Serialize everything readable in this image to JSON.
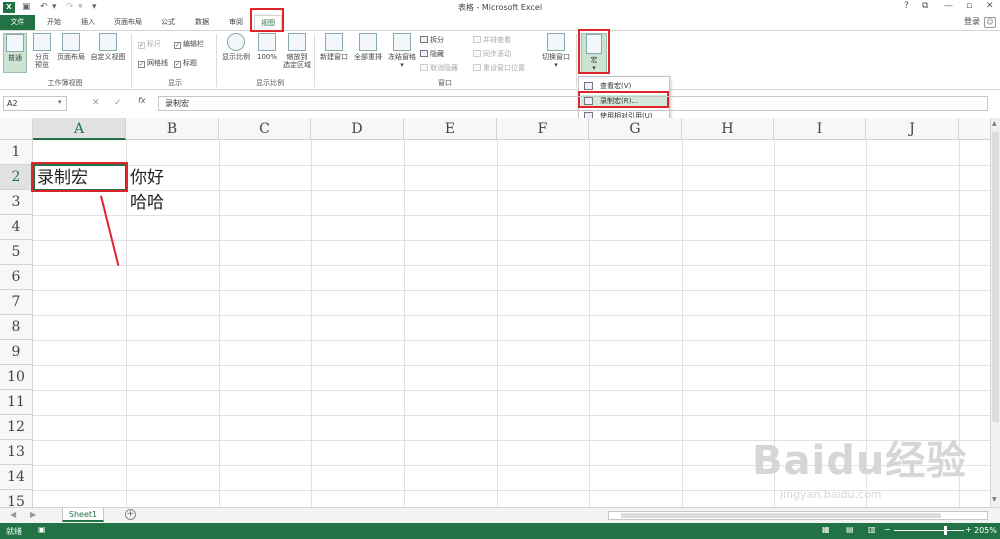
{
  "titlebar": {
    "title": "表格 - Microsoft Excel",
    "logo": "X"
  },
  "qat": {
    "save_icon": "save-icon",
    "undo": "↶",
    "redo": "↷",
    "customize": "▾"
  },
  "window_controls": {
    "help": "?",
    "restore": "⧉",
    "minimize": "—",
    "maximize": "▫",
    "close": "✕"
  },
  "tabs": [
    "文件",
    "开始",
    "插入",
    "页面布局",
    "公式",
    "数据",
    "审阅",
    "视图"
  ],
  "account": {
    "login": "登录"
  },
  "ribbon": {
    "workbook_views": {
      "label": "工作簿视图",
      "normal": "普通",
      "page_break_1": "分页",
      "page_break_2": "预览",
      "page_layout": "页面布局",
      "custom": "自定义视图"
    },
    "show": {
      "label": "显示",
      "ruler": "标尺",
      "gridlines": "网格线",
      "formula_bar": "编辑栏",
      "headings": "标题"
    },
    "zoom": {
      "label": "显示比例",
      "zoom": "显示比例",
      "hundred": "100%",
      "to_sel_1": "缩放到",
      "to_sel_2": "选定区域"
    },
    "window": {
      "label": "窗口",
      "new": "新建窗口",
      "arrange": "全部重排",
      "freeze": "冻结窗格",
      "split": "拆分",
      "hide": "隐藏",
      "unhide": "取消隐藏",
      "side_by_side": "并排查看",
      "sync": "同步滚动",
      "reset": "重设窗口位置",
      "switch": "切换窗口"
    },
    "macros": {
      "label": "宏",
      "button": "宏"
    }
  },
  "macro_menu": [
    "查看宏(V)",
    "录制宏(R)...",
    "使用相对引用(U)"
  ],
  "formula_bar": {
    "name_box": "A2",
    "cancel": "✕",
    "enter": "✓",
    "fx": "fx",
    "value": "录制宏"
  },
  "columns": [
    "A",
    "B",
    "C",
    "D",
    "E",
    "F",
    "G",
    "H",
    "I",
    "J"
  ],
  "rows": [
    "1",
    "2",
    "3",
    "4",
    "5",
    "6",
    "7",
    "8",
    "9",
    "10",
    "11",
    "12",
    "13",
    "14",
    "15"
  ],
  "cells": {
    "A2": "录制宏",
    "B2": "你好",
    "B3": "哈哈"
  },
  "sheets": {
    "active": "Sheet1",
    "add": "+"
  },
  "status": {
    "ready": "就绪",
    "zoom": "205%"
  },
  "watermark": {
    "brand": "Baidu经验",
    "url": "jingyan.baidu.com"
  },
  "colors": {
    "brand": "#217346",
    "highlight": "#e0242b"
  }
}
